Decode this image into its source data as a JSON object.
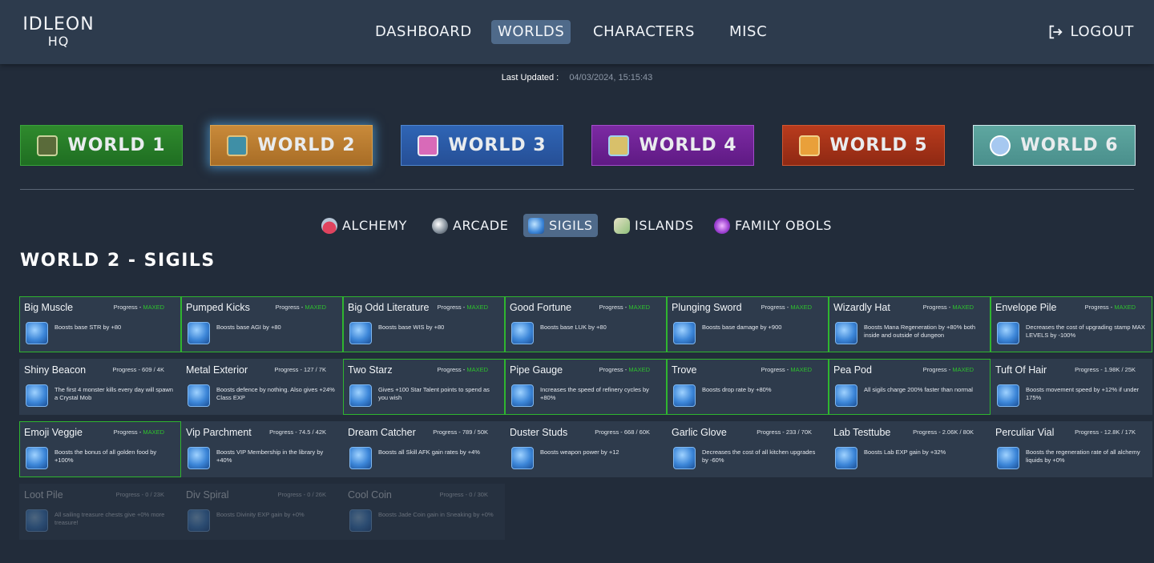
{
  "app": {
    "logo_line1": "IDLEON",
    "logo_line2": "HQ"
  },
  "nav": {
    "items": [
      {
        "label": "DASHBOARD"
      },
      {
        "label": "WORLDS"
      },
      {
        "label": "CHARACTERS"
      },
      {
        "label": "MISC"
      }
    ],
    "active": "WORLDS",
    "logout_label": "LOGOUT"
  },
  "last_updated": {
    "label": "Last Updated :",
    "value": "04/03/2024, 15:15:43"
  },
  "worlds": [
    {
      "label": "WORLD 1"
    },
    {
      "label": "WORLD 2"
    },
    {
      "label": "WORLD 3"
    },
    {
      "label": "WORLD 4"
    },
    {
      "label": "WORLD 5"
    },
    {
      "label": "WORLD 6"
    }
  ],
  "subtabs": [
    {
      "label": "ALCHEMY",
      "icon": "alchemy-flask-icon"
    },
    {
      "label": "ARCADE",
      "icon": "arcade-ball-icon"
    },
    {
      "label": "SIGILS",
      "icon": "sigil-icon"
    },
    {
      "label": "ISLANDS",
      "icon": "islands-bottle-icon"
    },
    {
      "label": "FAMILY OBOLS",
      "icon": "obol-icon"
    }
  ],
  "active_subtab": "SIGILS",
  "page_title": "WORLD 2 - SIGILS",
  "progress_prefix": "Progress - ",
  "sigils": [
    {
      "name": "Big Muscle",
      "progress": "MAXED",
      "desc": "Boosts base STR by +80",
      "maxed": true
    },
    {
      "name": "Pumped Kicks",
      "progress": "MAXED",
      "desc": "Boosts base AGI by +80",
      "maxed": true
    },
    {
      "name": "Big Odd Literature",
      "progress": "MAXED",
      "desc": "Boosts base WIS by +80",
      "maxed": true
    },
    {
      "name": "Good Fortune",
      "progress": "MAXED",
      "desc": "Boosts base LUK by +80",
      "maxed": true
    },
    {
      "name": "Plunging Sword",
      "progress": "MAXED",
      "desc": "Boosts base damage by +900",
      "maxed": true
    },
    {
      "name": "Wizardly Hat",
      "progress": "MAXED",
      "desc": "Boosts Mana Regeneration by +80% both inside and outside of dungeon",
      "maxed": true
    },
    {
      "name": "Envelope Pile",
      "progress": "MAXED",
      "desc": "Decreases the cost of upgrading stamp MAX LEVELS by -100%",
      "maxed": true
    },
    {
      "name": "Shiny Beacon",
      "progress": "609 / 4K",
      "desc": "The first 4 monster kills every day will spawn a Crystal Mob",
      "maxed": false
    },
    {
      "name": "Metal Exterior",
      "progress": "127 / 7K",
      "desc": "Boosts defence by nothing. Also gives +24% Class EXP",
      "maxed": false
    },
    {
      "name": "Two Starz",
      "progress": "MAXED",
      "desc": "Gives +100 Star Talent points to spend as you wish",
      "maxed": true
    },
    {
      "name": "Pipe Gauge",
      "progress": "MAXED",
      "desc": "Increases the speed of refinery cycles by +80%",
      "maxed": true
    },
    {
      "name": "Trove",
      "progress": "MAXED",
      "desc": "Boosts drop rate by +80%",
      "maxed": true
    },
    {
      "name": "Pea Pod",
      "progress": "MAXED",
      "desc": "All sigils charge 200% faster than normal",
      "maxed": true
    },
    {
      "name": "Tuft Of Hair",
      "progress": "1.98K / 25K",
      "desc": "Boosts movement speed by +12% if under 175%",
      "maxed": false
    },
    {
      "name": "Emoji Veggie",
      "progress": "MAXED",
      "desc": "Boosts the bonus of all golden food by +100%",
      "maxed": true
    },
    {
      "name": "Vip Parchment",
      "progress": "74.5 / 42K",
      "desc": "Boosts VIP Membership in the library by +40%",
      "maxed": false
    },
    {
      "name": "Dream Catcher",
      "progress": "789 / 50K",
      "desc": "Boosts all Skill AFK gain rates by +4%",
      "maxed": false
    },
    {
      "name": "Duster Studs",
      "progress": "668 / 60K",
      "desc": "Boosts weapon power by +12",
      "maxed": false
    },
    {
      "name": "Garlic Glove",
      "progress": "233 / 70K",
      "desc": "Decreases the cost of all kitchen upgrades by -60%",
      "maxed": false
    },
    {
      "name": "Lab Testtube",
      "progress": "2.06K / 80K",
      "desc": "Boosts Lab EXP gain by +32%",
      "maxed": false
    },
    {
      "name": "Perculiar Vial",
      "progress": "12.8K / 17K",
      "desc": "Boosts the regeneration rate of all alchemy liquids by +0%",
      "maxed": false
    },
    {
      "name": "Loot Pile",
      "progress": "0 / 23K",
      "desc": "All sailing treasure chests give +0% more treasure!",
      "maxed": false,
      "locked": true
    },
    {
      "name": "Div Spiral",
      "progress": "0 / 26K",
      "desc": "Boosts Divinity EXP gain by +0%",
      "maxed": false,
      "locked": true
    },
    {
      "name": "Cool Coin",
      "progress": "0 / 30K",
      "desc": "Boosts Jade Coin gain in Sneaking by +0%",
      "maxed": false,
      "locked": true
    }
  ]
}
